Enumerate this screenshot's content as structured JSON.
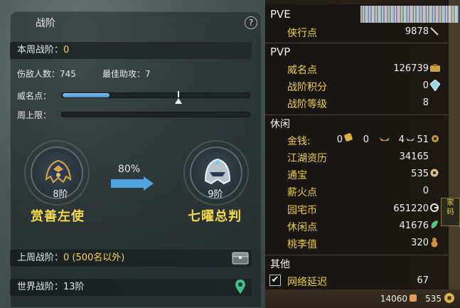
{
  "left_panel": {
    "title": "战阶",
    "help": "?",
    "weekly_rank": {
      "label": "本周战阶：",
      "value": "0"
    },
    "stats": {
      "kills_label": "伤敌人数：",
      "kills_value": "745",
      "assist_label": "最佳助攻：",
      "assist_value": "7"
    },
    "reputation": {
      "label": "威名点：",
      "progress": 0.25
    },
    "weekly_cap": {
      "label": "周上限：",
      "progress": 0
    },
    "current_rank": {
      "tier": "8阶",
      "name": "赏善左使"
    },
    "next_rank": {
      "tier": "9阶",
      "name": "七曜总判"
    },
    "advance_percent": "80%",
    "last_week": {
      "label": "上周战阶：",
      "value": "0 (500名以外)"
    },
    "world": {
      "label": "世界战阶：",
      "value": "13阶"
    },
    "icons": {
      "help": "help-icon",
      "chest": "chest-icon",
      "location": "map-pin-icon"
    }
  },
  "right_panel": {
    "pve": {
      "title": "PVE",
      "items": [
        {
          "label": "侠行点",
          "value": "9878",
          "icon": "brush-icon"
        }
      ]
    },
    "pvp": {
      "title": "PVP",
      "items": [
        {
          "label": "威名点",
          "value": "126739",
          "icon": "bag-icon"
        },
        {
          "label": "战阶积分",
          "value": "0",
          "icon": "crystal-icon"
        },
        {
          "label": "战阶等级",
          "value": "8"
        }
      ]
    },
    "leisure": {
      "title": "休闲",
      "gold": {
        "label": "金钱:",
        "v1": "0",
        "v2": "0",
        "v3": "4",
        "v4": "51"
      },
      "items": [
        {
          "label": "江湖资历",
          "value": "34165"
        },
        {
          "label": "通宝",
          "value": "535",
          "icon": "coin-icon"
        },
        {
          "label": "薪火点",
          "value": "0"
        },
        {
          "label": "园宅币",
          "value": "651220",
          "icon": "house-coin-icon"
        },
        {
          "label": "休闲点",
          "value": "41676",
          "icon": "leaf-icon"
        },
        {
          "label": "桃李值",
          "value": "320",
          "icon": "gourd-icon"
        }
      ]
    },
    "other": {
      "title": "其他",
      "latency": {
        "label": "网络延迟",
        "value": "67",
        "checked": true
      }
    },
    "footer": {
      "value1": "14060",
      "value2": "535"
    },
    "side_sign": "家\n码"
  },
  "colors": {
    "accent_yellow": "#f3d44a",
    "progress_blue": "#3c8fd2",
    "panel_dark": "#121010"
  }
}
